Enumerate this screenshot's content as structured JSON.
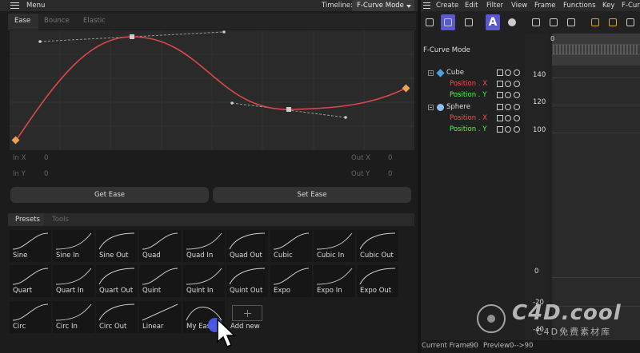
{
  "header": {
    "menu_label": "Menu",
    "timeline_label": "Timeline:",
    "timeline_mode": "F-Curve Mode"
  },
  "ease_tabs": [
    {
      "label": "Ease",
      "active": true
    },
    {
      "label": "Bounce",
      "active": false
    },
    {
      "label": "Elastic",
      "active": false
    }
  ],
  "curve": {
    "color": "#d9484c",
    "handle_color": "#f0a050"
  },
  "fields": {
    "in_x_label": "In X",
    "in_x_value": "0",
    "in_y_label": "In Y",
    "in_y_value": "0",
    "out_x_label": "Out X",
    "out_x_value": "0",
    "out_y_label": "Out Y",
    "out_y_value": "0"
  },
  "buttons": {
    "get_ease": "Get Ease",
    "set_ease": "Set Ease"
  },
  "preset_tabs": [
    {
      "label": "Presets",
      "active": true
    },
    {
      "label": "Tools",
      "active": false
    }
  ],
  "presets": [
    {
      "label": "Sine",
      "curve": "ease-in-out"
    },
    {
      "label": "Sine In",
      "curve": "ease-in"
    },
    {
      "label": "Sine Out",
      "curve": "ease-out"
    },
    {
      "label": "Quad",
      "curve": "ease-in-out"
    },
    {
      "label": "Quad In",
      "curve": "ease-in"
    },
    {
      "label": "Quad Out",
      "curve": "ease-out"
    },
    {
      "label": "Cubic",
      "curve": "ease-in-out"
    },
    {
      "label": "Cubic In",
      "curve": "ease-in"
    },
    {
      "label": "Cubic Out",
      "curve": "ease-out"
    },
    {
      "label": "Quart",
      "curve": "ease-in-out"
    },
    {
      "label": "Quart In",
      "curve": "ease-in"
    },
    {
      "label": "Quart Out",
      "curve": "ease-out"
    },
    {
      "label": "Quint",
      "curve": "ease-in-out"
    },
    {
      "label": "Quint In",
      "curve": "ease-in"
    },
    {
      "label": "Quint Out",
      "curve": "ease-out"
    },
    {
      "label": "Expo",
      "curve": "ease-in-out"
    },
    {
      "label": "Expo In",
      "curve": "ease-in"
    },
    {
      "label": "Expo Out",
      "curve": "ease-out"
    },
    {
      "label": "Circ",
      "curve": "ease-in-out"
    },
    {
      "label": "Circ In",
      "curve": "ease-in"
    },
    {
      "label": "Circ Out",
      "curve": "ease-out"
    },
    {
      "label": "Linear",
      "curve": "linear"
    },
    {
      "label": "My Ease",
      "curve": "overshoot"
    }
  ],
  "add_new_label": "Add new",
  "right_menu": [
    "Create",
    "Edit",
    "Filter",
    "View",
    "Frame",
    "Functions",
    "Key",
    "F-Cur"
  ],
  "fcurve_mode_label": "F-Curve Mode",
  "tree": [
    {
      "label": "Cube",
      "kind": "object",
      "icon": "cube-icon",
      "color": "#dddddd"
    },
    {
      "label": "Position . X",
      "kind": "track",
      "color": "#ff4a4a"
    },
    {
      "label": "Position . Y",
      "kind": "track",
      "color": "#4aff4a"
    },
    {
      "label": "Sphere",
      "kind": "object",
      "icon": "sphere-icon",
      "color": "#dddddd"
    },
    {
      "label": "Position . X",
      "kind": "track",
      "color": "#ff4a4a"
    },
    {
      "label": "Position . Y",
      "kind": "track",
      "color": "#4aff4a"
    }
  ],
  "graph": {
    "ruler_zero": "0",
    "y_labels": [
      "140",
      "120",
      "100",
      "0",
      "-20",
      "-40"
    ]
  },
  "status": {
    "current_frame_label": "Current Frame",
    "current_frame_value": "90",
    "preview_label": "Preview",
    "preview_range": "0-->90"
  },
  "watermark": {
    "text": "C4D.cool",
    "sub": "C4D免费素材库"
  }
}
